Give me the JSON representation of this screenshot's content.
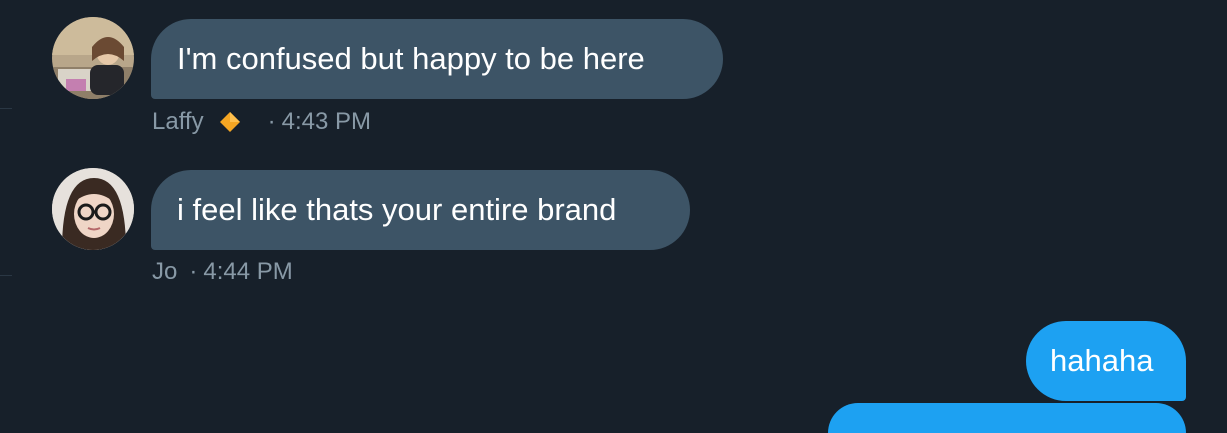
{
  "messages": [
    {
      "sender": "Laffy",
      "text": "I'm confused but happy to be here",
      "time": "4:43 PM",
      "separator": "·",
      "badge": "orange-diamond-icon"
    },
    {
      "sender": "Jo",
      "text": "i feel like thats your entire brand",
      "time": "4:44 PM",
      "separator": "·"
    },
    {
      "text": "hahaha"
    }
  ],
  "colors": {
    "background": "#17202a",
    "incoming_bubble": "#3d5466",
    "outgoing_bubble": "#1da1f2",
    "meta_text": "#8899a6",
    "badge": "#f5a623"
  }
}
